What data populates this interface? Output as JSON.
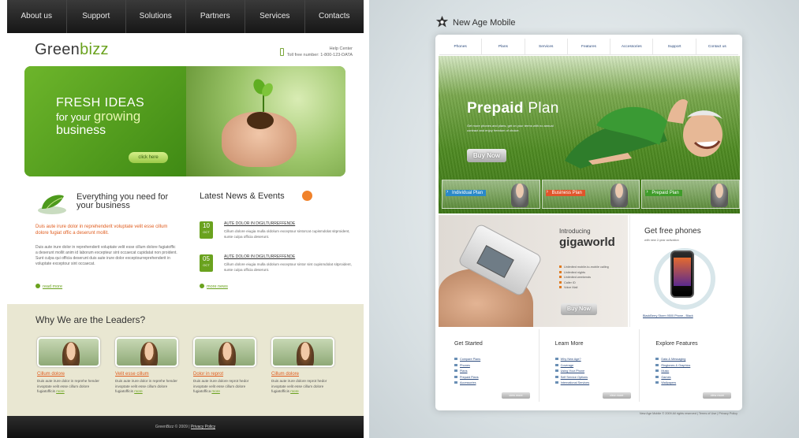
{
  "greenbizz": {
    "nav": [
      "About us",
      "Support",
      "Solutions",
      "Partners",
      "Services",
      "Contacts"
    ],
    "logo": {
      "part1": "Green",
      "part2": "bizz"
    },
    "help": {
      "title": "Help Center",
      "phone": "Toll free number: 1-800-123-DATA"
    },
    "banner": {
      "line1": "FRESH IDEAS",
      "line2_prefix": "for your",
      "line2_emph": "growing",
      "line3": "business",
      "button": "click here"
    },
    "feature": {
      "title": "Everything you need for your business",
      "lead": "Duis aute irure dolor in reprehenderit voluptate velit esse cillum dolore fugiat offic a deserunt mollit.",
      "body": "Duis aute irure dolor in reprehenderit voluptate velit esse cillum dolore fugiatoffic a deserunt mollit anim id laborum excepteur sint occaecat cupidatat non proident. Sunt culpa qui officia deserunt duis aute irure dolor exceptourreprehenderit in voluptate exceptour sint occaecat.",
      "more": "read more"
    },
    "news": {
      "title": "Latest News & Events",
      "items": [
        {
          "day": "10",
          "month": "OCT",
          "title": "AUTE DOLOR IN DIGILTURREFFENDE",
          "text": "Cillum dolore eiugia mulla oldolum exceptour sintorcat cupismdolat sitproident, sunte culpa officia deserunt."
        },
        {
          "day": "05",
          "month": "OCT",
          "title": "AUTE DOLOR IN DIGILTURREFFENDE",
          "text": "Cillum dolore eiugia mulla oldolum exceptour sintor sint cupismdolat sitproident, sunte culpa officia deserunt."
        }
      ],
      "more": "more news"
    },
    "leaders": {
      "title": "Why We are the Leaders?",
      "cards": [
        {
          "name": "Cillum dolore",
          "text": "Duis aute irure dolor in reprehe hender invoptate velit esse cillum dolore fugiatofficis",
          "more": "more"
        },
        {
          "name": "Velit esse cillum",
          "text": "Duis aute irure dolor in reprehe hender invoptate velit esse cillum dolore fugiatofficis",
          "more": "more"
        },
        {
          "name": "Dolor in reprot",
          "text": "Duis aute irure dolore reprot hedor invoptate velit esse cillum dolore fugiatoffica",
          "more": "more"
        },
        {
          "name": "Cillum dolore",
          "text": "Duis aute irure dolore reprot hedor invoptate velit esse cillum dolore fugiatofficis",
          "more": "more"
        }
      ]
    },
    "footer": {
      "copy": "GreenBizz © 2009",
      "sep": "|",
      "privacy": "Privacy Policy"
    }
  },
  "newage": {
    "logo": "New Age Mobile",
    "nav": [
      "Phones",
      "Plans",
      "Services",
      "Features",
      "Accessories",
      "Support",
      "Contact us"
    ],
    "hero": {
      "title_bold": "Prepaid",
      "title_rest": "Plan",
      "subtitle": "Get more phones and plans, get on your terms with no annual contract and enjoy freedom of choice.",
      "button": "Buy Now",
      "tabs": [
        "Individual Plan",
        "Business Plan",
        "Prepaid Plan"
      ]
    },
    "promo1": {
      "intro": "Introducing",
      "product": "gigaworld",
      "features": [
        "Unlimited mobile-to-mobile calling",
        "Unlimited nights",
        "Unlimited weekends",
        "Caller ID",
        "Voice Mail"
      ],
      "button": "Buy Now"
    },
    "promo2": {
      "title": "Get free phones",
      "subtitle": "with new 2-year activation",
      "link": "BlackBerry Storm 9500 Phone - Black"
    },
    "columns": [
      {
        "title": "Get Started",
        "links": [
          "Compare Plans",
          "Phones",
          "Plans",
          "Prepaid Plans",
          "Accessories"
        ],
        "button": "view more"
      },
      {
        "title": "Learn More",
        "links": [
          "Why New Age?",
          "Coverage",
          "Using Your Phone",
          "Self Service Options",
          "International Services"
        ],
        "button": "view more"
      },
      {
        "title": "Explore Features",
        "links": [
          "Data & Messaging",
          "Ringtones & Graphics",
          "Music",
          "Games",
          "Wallpapers"
        ],
        "button": "view more"
      }
    ],
    "footer": "New Age Mobile © 2009 All rights reserved  |  Terms of Use  |  Privacy Policy"
  }
}
